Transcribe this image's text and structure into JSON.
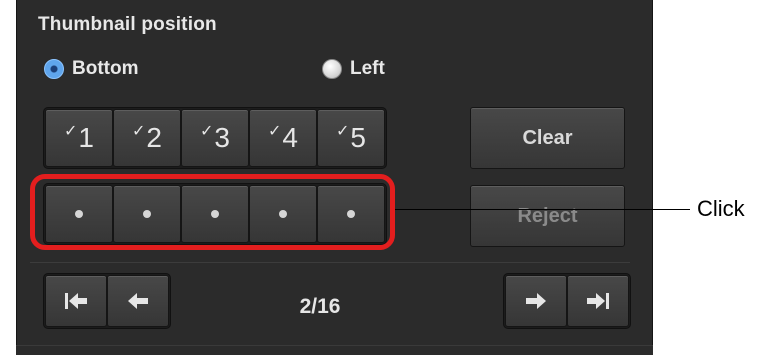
{
  "thumbnail_position": {
    "title": "Thumbnail position",
    "options": [
      {
        "label": "Bottom",
        "selected": true
      },
      {
        "label": "Left",
        "selected": false
      }
    ]
  },
  "rating_buttons": [
    {
      "check": "✓",
      "number": "1"
    },
    {
      "check": "✓",
      "number": "2"
    },
    {
      "check": "✓",
      "number": "3"
    },
    {
      "check": "✓",
      "number": "4"
    },
    {
      "check": "✓",
      "number": "5"
    }
  ],
  "clear_label": "Clear",
  "reject_label": "Reject",
  "callout_label": "Click",
  "navigation": {
    "page_indicator": "2/16"
  },
  "colors": {
    "panel_bg": "#2b2b2b",
    "highlight": "#e31e1e",
    "radio_selected": "#5fa5ec"
  }
}
